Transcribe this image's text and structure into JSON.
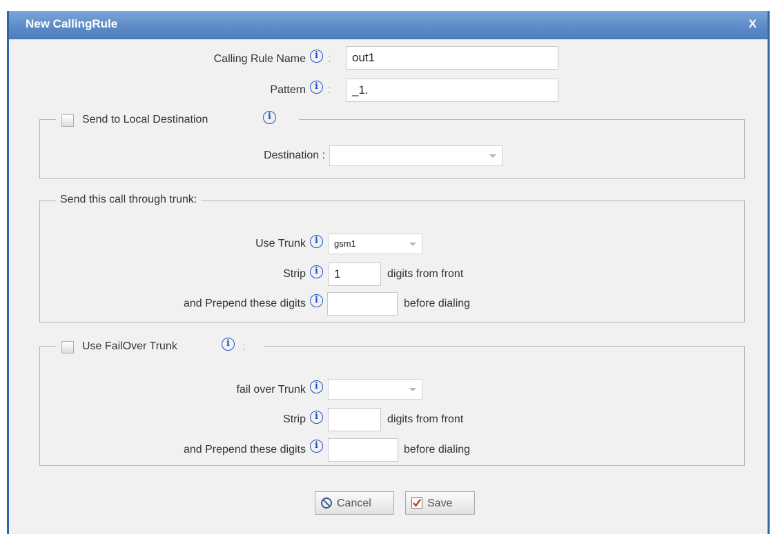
{
  "dialog": {
    "title": "New CallingRule",
    "close_label": "X"
  },
  "fields": {
    "calling_rule_name_label": "Calling Rule Name",
    "calling_rule_name_value": "out1",
    "pattern_label": "Pattern",
    "pattern_value": "_1.",
    "colon": ":",
    "info_glyph": "i"
  },
  "local_destination": {
    "legend": "Send to Local Destination",
    "checked": false,
    "destination_label": "Destination :",
    "destination_value": ""
  },
  "trunk": {
    "legend": "Send this call through trunk:",
    "use_trunk_label": "Use Trunk",
    "use_trunk_value": "gsm1",
    "strip_label": "Strip",
    "strip_value": "1",
    "strip_suffix": "digits from front",
    "prepend_label": "and Prepend these digits",
    "prepend_value": "",
    "prepend_suffix": "before dialing"
  },
  "failover": {
    "legend": "Use FailOver Trunk",
    "checked": false,
    "colon": ":",
    "fail_over_trunk_label": "fail over Trunk",
    "fail_over_trunk_value": "",
    "strip_label": "Strip",
    "strip_value": "",
    "strip_suffix": "digits from front",
    "prepend_label": "and Prepend these digits",
    "prepend_value": "",
    "prepend_suffix": "before dialing"
  },
  "buttons": {
    "cancel_label": "Cancel",
    "save_label": "Save"
  },
  "colors": {
    "titlebar": "#5e8cc8",
    "frame": "#2f64a8",
    "info_icon": "#1f50c8",
    "save_icon": "#c0392b"
  },
  "icons": {
    "info": "info-icon",
    "cancel": "cancel-icon",
    "save": "checkbox-save-icon",
    "dropdown": "chevron-down-icon"
  }
}
